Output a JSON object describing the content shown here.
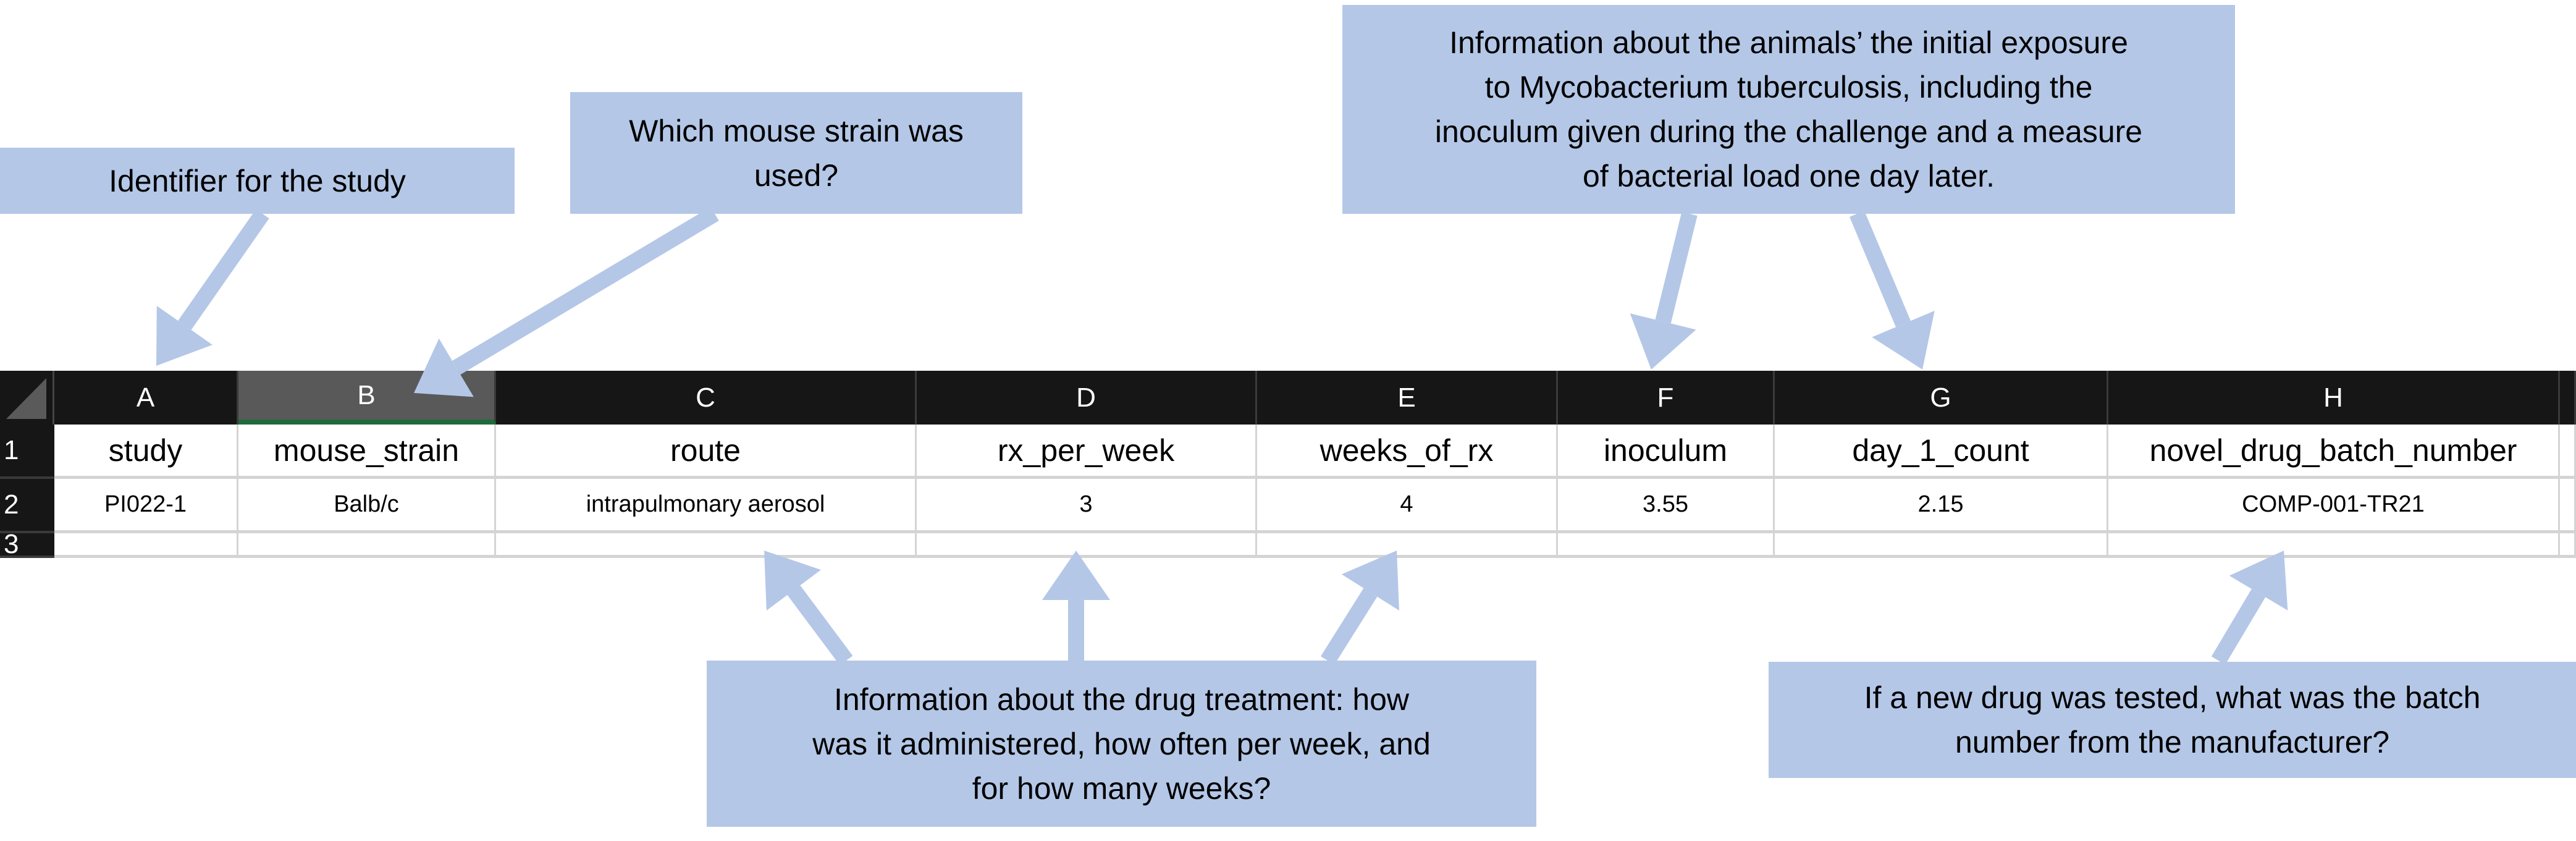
{
  "spreadsheet": {
    "columns": [
      "A",
      "B",
      "C",
      "D",
      "E",
      "F",
      "G",
      "H"
    ],
    "selected_column": "B",
    "rows": [
      {
        "number": "1",
        "cells": [
          "study",
          "mouse_strain",
          "route",
          "rx_per_week",
          "weeks_of_rx",
          "inoculum",
          "day_1_count",
          "novel_drug_batch_number"
        ]
      },
      {
        "number": "2",
        "cells": [
          "PI022-1",
          "Balb/c",
          "intrapulmonary aerosol",
          "3",
          "4",
          "3.55",
          "2.15",
          "COMP-001-TR21"
        ]
      },
      {
        "number": "3",
        "cells": [
          "",
          "",
          "",
          "",
          "",
          "",
          "",
          ""
        ]
      }
    ]
  },
  "callouts": {
    "study": [
      "Identifier for the study"
    ],
    "strain": [
      "Which mouse strain was",
      "used?"
    ],
    "exposure": [
      "Information about the animals’ the initial exposure",
      "to Mycobacterium tuberculosis, including the",
      "inoculum given during the challenge and a measure",
      "of bacterial load one day later."
    ],
    "treatment": [
      "Information about the drug treatment: how",
      "was it administered, how often per week, and",
      "for how many weeks?"
    ],
    "batch": [
      "If a new drug was tested, what was the batch",
      "number from the manufacturer?"
    ]
  },
  "colors": {
    "callout": "#b4c7e7",
    "header_bg": "#161616",
    "selected_header": "#595959",
    "selection_accent": "#1e6b3c"
  }
}
